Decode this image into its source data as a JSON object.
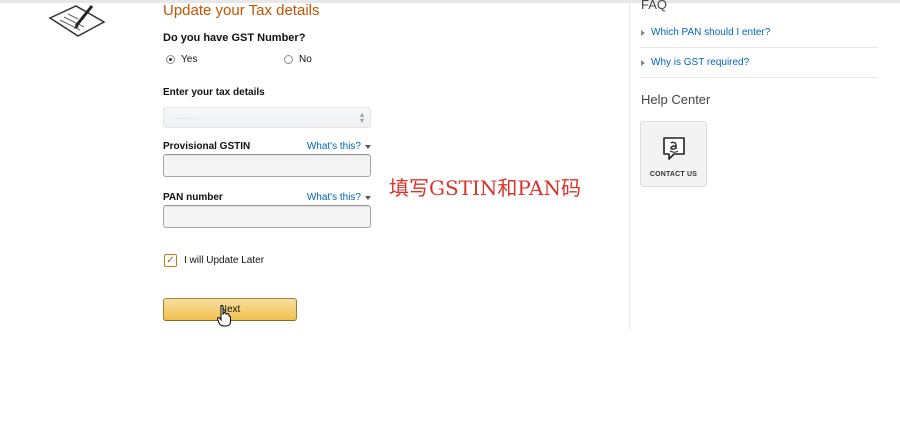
{
  "page": {
    "title": "Update your Tax details",
    "gst_question": "Do you have GST Number?",
    "gst_options": [
      {
        "label": "Yes",
        "selected": true
      },
      {
        "label": "No",
        "selected": false
      }
    ],
    "tax_details_label": "Enter your tax details",
    "select_value": "········",
    "provisional_gstin": {
      "label": "Provisional GSTIN",
      "help": "What's this?",
      "value": ""
    },
    "pan_number": {
      "label": "PAN number",
      "help": "What's this?",
      "value": ""
    },
    "update_later": {
      "label": "I will Update Later",
      "checked": true
    },
    "next_label": "Next"
  },
  "annotation": {
    "text": "填写GSTIN和PAN码",
    "color": "#d9342b"
  },
  "sidebar": {
    "faq_title": "FAQ",
    "faq_items": [
      "Which PAN should I enter?",
      "Why is GST required?"
    ],
    "help_title": "Help Center",
    "contact_label": "CONTACT US"
  },
  "colors": {
    "title_orange": "#c45500",
    "link_blue": "#0066c0",
    "button_gold": "#f0c14b"
  }
}
